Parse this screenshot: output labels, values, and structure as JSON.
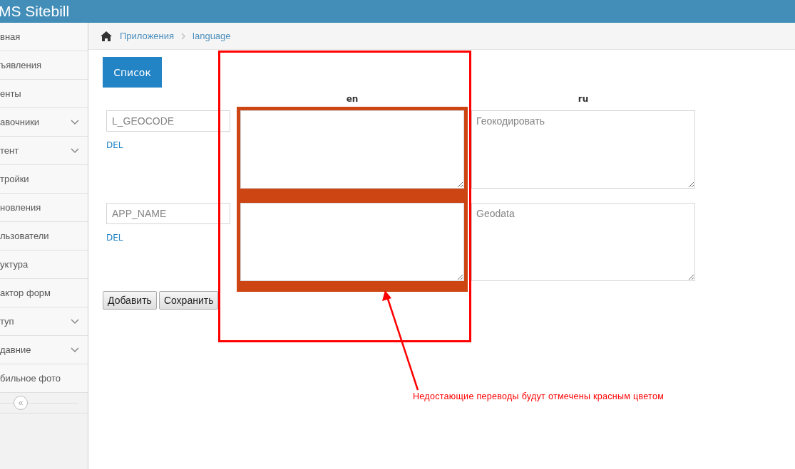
{
  "header": {
    "title": "MS Sitebill"
  },
  "sidebar": {
    "items": [
      {
        "label": "вная",
        "expandable": false
      },
      {
        "label": "ъявления",
        "expandable": false
      },
      {
        "label": "енты",
        "expandable": false
      },
      {
        "label": "авочники",
        "expandable": true
      },
      {
        "label": "тент",
        "expandable": true
      },
      {
        "label": "тройки",
        "expandable": false
      },
      {
        "label": "новления",
        "expandable": false
      },
      {
        "label": "льзователи",
        "expandable": false
      },
      {
        "label": "уктура",
        "expandable": false
      },
      {
        "label": "актор форм",
        "expandable": false
      },
      {
        "label": "туп",
        "expandable": true
      },
      {
        "label": "давние",
        "expandable": true
      },
      {
        "label": "бильное фото",
        "expandable": false
      }
    ],
    "collapse": "«"
  },
  "breadcrumb": [
    "Приложения",
    "language"
  ],
  "list_button": "Список",
  "columns": [
    "en",
    "ru"
  ],
  "rows": [
    {
      "key": "L_GEOCODE",
      "del": "DEL",
      "en": {
        "missing": true
      },
      "ru": {
        "value": "Геокодировать",
        "missing": false
      }
    },
    {
      "key": "APP_NAME",
      "del": "DEL",
      "en": {
        "missing": true
      },
      "ru": {
        "value": "Geodata",
        "missing": false
      }
    }
  ],
  "buttons": [
    "Добавить",
    "Сохранить"
  ],
  "annotation": {
    "text": "Недостающие переводы будут отмечены красным цветом"
  }
}
